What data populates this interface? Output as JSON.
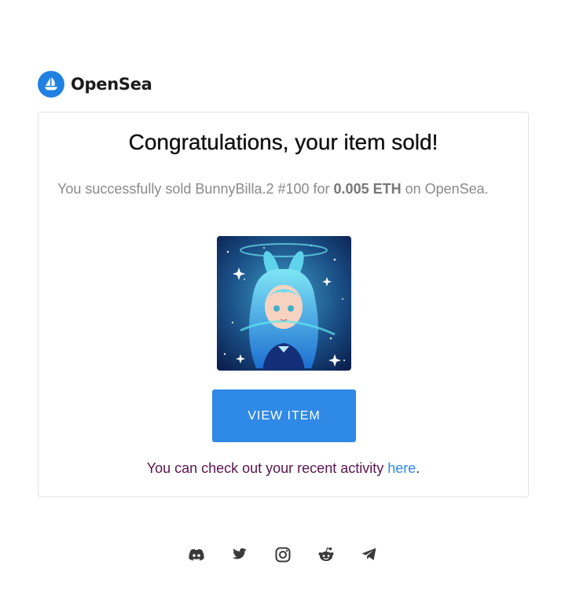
{
  "brand": {
    "name": "OpenSea",
    "logo_icon": "opensea-boat-icon",
    "accent_color": "#2081e2"
  },
  "card": {
    "title": "Congratulations, your item sold!",
    "message_prefix": "You successfully sold BunnyBilla.2 #100 for ",
    "price": "0.005 ETH",
    "message_suffix": " on OpenSea.",
    "item_image": "bunny-girl-nft-artwork",
    "view_button_label": "VIEW ITEM",
    "button_color": "#2f89e6",
    "activity_prefix": "You can check out your recent activity ",
    "activity_link": "here",
    "activity_suffix": "."
  },
  "footer": {
    "social_icons": [
      "discord-icon",
      "twitter-icon",
      "instagram-icon",
      "reddit-icon",
      "telegram-icon"
    ]
  }
}
